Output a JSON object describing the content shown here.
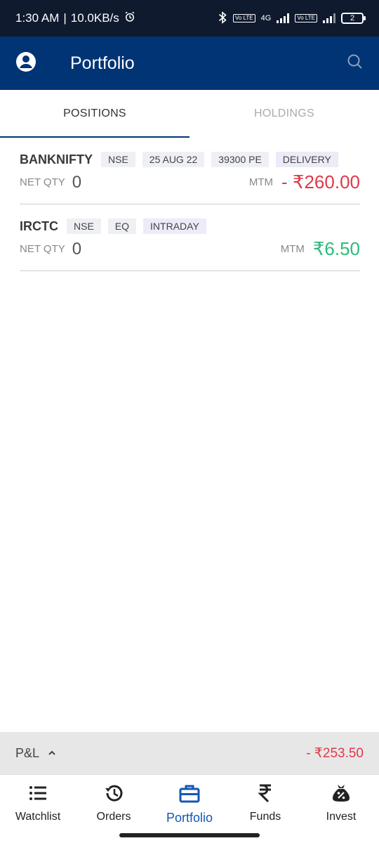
{
  "status": {
    "time": "1:30 AM",
    "speed": "10.0KB/s",
    "volte": "Vo LTE",
    "net": "4G",
    "battery": "2"
  },
  "appbar": {
    "title": "Portfolio"
  },
  "tabs": [
    {
      "label": "POSITIONS",
      "active": true
    },
    {
      "label": "HOLDINGS",
      "active": false
    }
  ],
  "positions": [
    {
      "symbol": "BANKNIFTY",
      "tags": [
        "NSE",
        "25 AUG 22",
        "39300 PE"
      ],
      "type": "DELIVERY",
      "qty_label": "NET QTY",
      "qty": "0",
      "mtm_label": "MTM",
      "mtm": "- ₹260.00",
      "mtm_color": "#e0394b"
    },
    {
      "symbol": "IRCTC",
      "tags": [
        "NSE",
        "EQ"
      ],
      "type": "INTRADAY",
      "qty_label": "NET QTY",
      "qty": "0",
      "mtm_label": "MTM",
      "mtm": "₹6.50",
      "mtm_color": "#2dbb7a"
    }
  ],
  "pnl": {
    "label": "P&L",
    "value": "- ₹253.50"
  },
  "nav": [
    {
      "label": "Watchlist",
      "icon": "list-icon"
    },
    {
      "label": "Orders",
      "icon": "history-icon"
    },
    {
      "label": "Portfolio",
      "icon": "briefcase-icon",
      "active": true
    },
    {
      "label": "Funds",
      "icon": "rupee-icon"
    },
    {
      "label": "Invest",
      "icon": "money-bag-icon"
    }
  ],
  "colors": {
    "appbar": "#013474",
    "accent": "#1357b5",
    "negative": "#e0394b",
    "positive": "#2dbb7a"
  }
}
